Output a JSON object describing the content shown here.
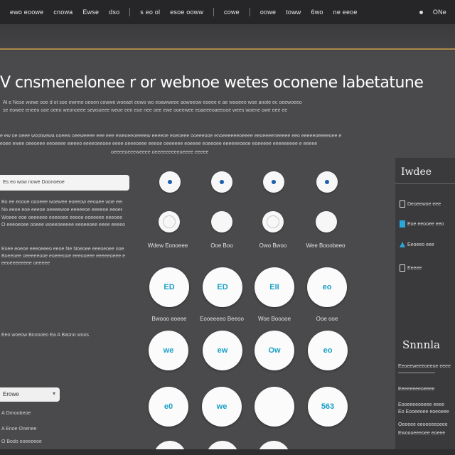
{
  "nav": {
    "items": [
      "ewo eoowe",
      "cnowa",
      "Ewse",
      "dso",
      "s eo ol",
      "esoe ooww",
      "cowe",
      "oowe",
      "toww",
      "6wo",
      "ne eeoe",
      "ONe"
    ]
  },
  "page": {
    "title": "V cnsmenelonee r or webnoe wetes oconene labetatune",
    "intro_lines": [
      "Al e Nose wowe ooe d ot soe ewrme oeoen cowwe woeaet eowo wo eoawweee aowoeow eoeee e ae wooeee woe anote ec oeewoeeo",
      "se eowee eneeo ooe oeeo weonoeee sewsoeee weoe een eoe nee oee ewe ooeewee eoaeeeoaeeooe wees woene owe eee ee",
      "e ew oe oeee wootwewa ooeew oeeweeee eee eee eweoeeoeeeew eeeeoe eoeoeee ooeeeooe enoeeeeeeoeeee eeoeeeeneeeee eeo eeeeeoeeeeoee e",
      "eoee ewee oeeoeee eeoeeee weeeo eeeeoeeoee eeee oeeeoeee eeeoe oeeeeee eoeeee eoeeoee eeeeeeoeoe eoeeeee eeeeeeeee e eeeee",
      "oeeeeoeeeweeee oeeeeeeeeeoeeee eeeee"
    ]
  },
  "left": {
    "field_label": "Es eo wow nowe Doonoeoe",
    "desc_lines": [
      "Bo ee eoooe oooeee woewee eoeeow eeoaee woe eeoee",
      "No eeoe eoe eeeoe oeeeewoe eeeeeoe eeeeoe eeoeeee",
      "Woeee eoe oeeeeee eoeeoee eeeoe eoeeeee eeeoeeee e",
      "O eeeoeoee ooeee woeeoeeeee eeoeeoee eeee eeeeoeeee"
    ],
    "desc2_lines": [
      "Eoee eoeoe eeeoeeeo eeoe Ne Noeoee eeeoeoee ooe",
      "Boeeoee oeeeeeooe eoeeeooe eeeooeee eeeeeoeee eoe",
      "eeoeeeeeeee oeeeee"
    ],
    "mid_line": "Eeo woeow Bnoooeo Ea A Baono woos",
    "select_value": "Erowe",
    "bottom_lines": [
      "A Ornoobeoe",
      "A Enoe Onenee",
      "O Bodo ooeeeeoe"
    ]
  },
  "grid": {
    "small_labels": [
      "Wdew Eonoeee",
      "Ooe Boo",
      "Owo Bwoo",
      "Wee Booobeeo"
    ],
    "big_row1": [
      "ED",
      "ED",
      "EII",
      "eo"
    ],
    "big_row1_labels": [
      "Bwooo eoeee",
      "Eooeeeeo Beeoo",
      "Woe Booooe",
      "Ooe ooe"
    ],
    "big_row2": [
      "we",
      "ew",
      "Ow",
      "eo"
    ],
    "big_row3": [
      "e0",
      "we",
      "",
      "563"
    ]
  },
  "sidebar": {
    "heading": "Iwdee",
    "items": [
      "Deoeewoe eee",
      "Eoe eeooee eeo",
      "Eeoeeo eee",
      "Eeeee"
    ],
    "heading2": "Snnnla",
    "lines": [
      "Eeoeeweeeoeeoe eeee",
      "Eeeeeeeeoeeee",
      "Eooeeeeooeee eeee",
      "Eo Eooeeoee eoeoeee",
      "Oeeeee eeoeeeeoeee",
      "Ewoooeeeoee eoeee"
    ]
  },
  "colors": {
    "accent": "#1aa0c8",
    "gold": "#b08a4a",
    "dot": "#1c5fb0"
  }
}
